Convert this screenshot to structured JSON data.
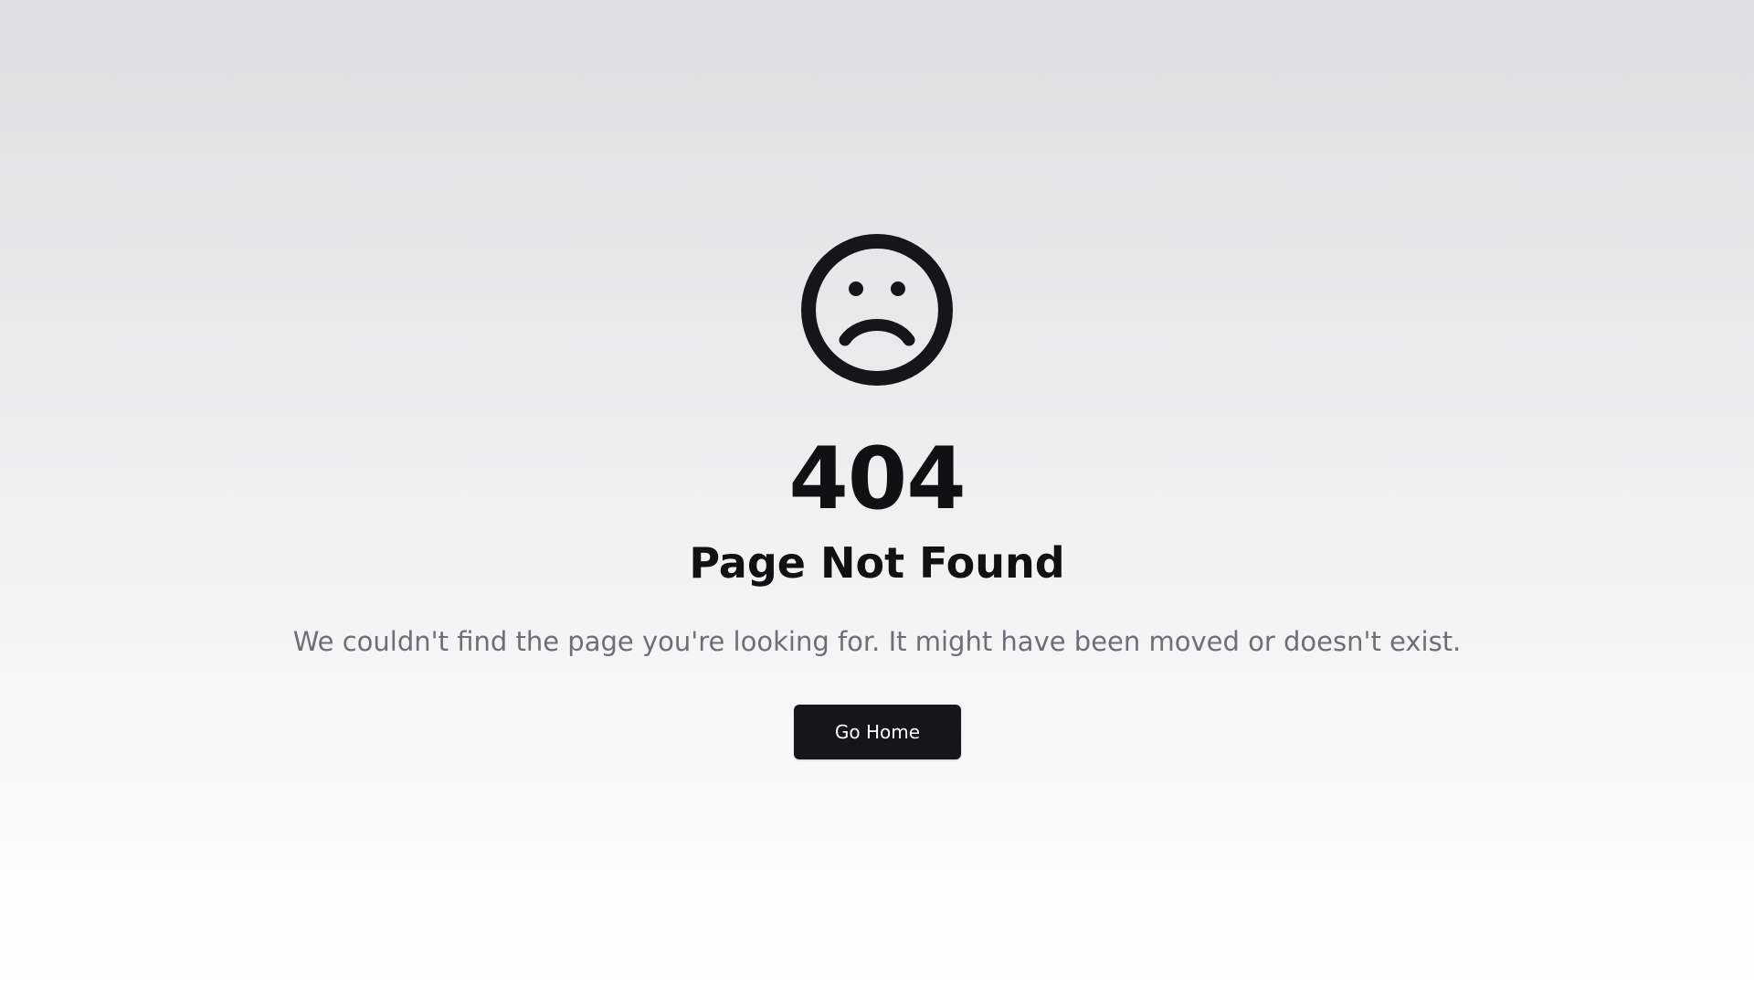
{
  "error": {
    "icon": "sad-face-icon",
    "code": "404",
    "title": "Page Not Found",
    "message": "We couldn't find the page you're looking for. It might have been moved or doesn't exist."
  },
  "actions": {
    "home_label": "Go Home"
  },
  "colors": {
    "text": "#111114",
    "muted": "#6e6e78",
    "button_bg": "#16161a",
    "button_text": "#ffffff"
  }
}
